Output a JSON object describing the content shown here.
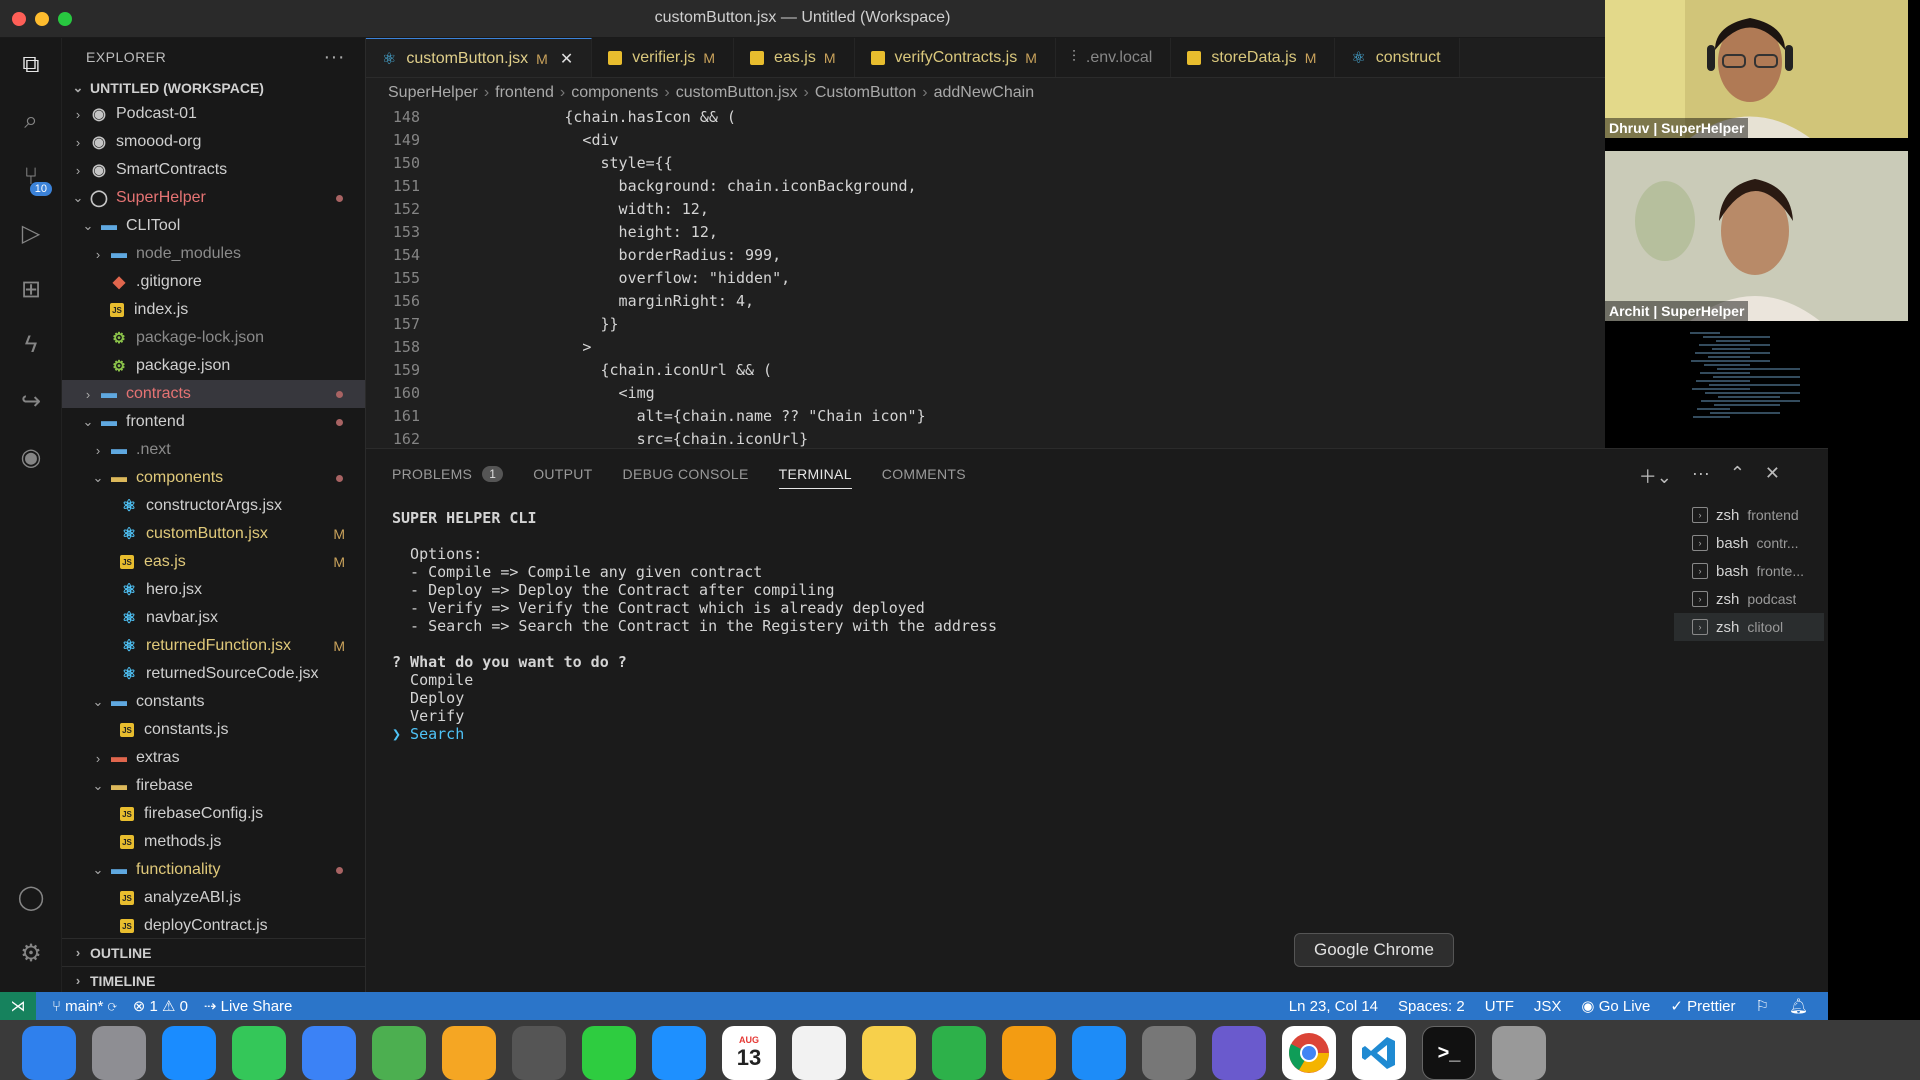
{
  "window": {
    "title": "customButton.jsx — Untitled (Workspace)"
  },
  "activity_bar": [
    {
      "icon": "files-icon"
    },
    {
      "icon": "search-icon"
    },
    {
      "icon": "source-control-icon",
      "badge": "10"
    },
    {
      "icon": "run-debug-icon"
    },
    {
      "icon": "extensions-icon"
    },
    {
      "icon": "lightning-icon"
    },
    {
      "icon": "live-share-icon"
    },
    {
      "icon": "github-icon"
    }
  ],
  "explorer": {
    "title": "EXPLORER",
    "workspace": "UNTITLED (WORKSPACE)",
    "items": [
      {
        "label": "Podcast-01",
        "depth": 0,
        "kind": "root",
        "chev": "›"
      },
      {
        "label": "smoood-org",
        "depth": 0,
        "kind": "root",
        "chev": "›"
      },
      {
        "label": "SmartContracts",
        "depth": 0,
        "kind": "root",
        "chev": "›"
      },
      {
        "label": "SuperHelper",
        "depth": 0,
        "kind": "root-open",
        "chev": "⌄",
        "color": "red",
        "dot": true
      },
      {
        "label": "CLITool",
        "depth": 1,
        "kind": "folder",
        "chev": "⌄"
      },
      {
        "label": "node_modules",
        "depth": 2,
        "kind": "folder-node",
        "chev": "›",
        "color": "dim"
      },
      {
        "label": ".gitignore",
        "depth": 2,
        "kind": "git"
      },
      {
        "label": "index.js",
        "depth": 2,
        "kind": "js"
      },
      {
        "label": "package-lock.json",
        "depth": 2,
        "kind": "json",
        "color": "dim"
      },
      {
        "label": "package.json",
        "depth": 2,
        "kind": "json"
      },
      {
        "label": "contracts",
        "depth": 1,
        "kind": "folder",
        "chev": "›",
        "color": "red",
        "dot": true,
        "selected": true
      },
      {
        "label": "frontend",
        "depth": 1,
        "kind": "folder",
        "chev": "⌄",
        "dot": true
      },
      {
        "label": ".next",
        "depth": 2,
        "kind": "folder",
        "chev": "›",
        "color": "dim"
      },
      {
        "label": "components",
        "depth": 2,
        "kind": "folder-y",
        "chev": "⌄",
        "color": "gold",
        "dot": true
      },
      {
        "label": "constructorArgs.jsx",
        "depth": 3,
        "kind": "react"
      },
      {
        "label": "customButton.jsx",
        "depth": 3,
        "kind": "react",
        "color": "gold",
        "mod": "M"
      },
      {
        "label": "eas.js",
        "depth": 3,
        "kind": "js",
        "color": "gold",
        "mod": "M"
      },
      {
        "label": "hero.jsx",
        "depth": 3,
        "kind": "react"
      },
      {
        "label": "navbar.jsx",
        "depth": 3,
        "kind": "react"
      },
      {
        "label": "returnedFunction.jsx",
        "depth": 3,
        "kind": "react",
        "color": "gold",
        "mod": "M"
      },
      {
        "label": "returnedSourceCode.jsx",
        "depth": 3,
        "kind": "react"
      },
      {
        "label": "constants",
        "depth": 2,
        "kind": "folder",
        "chev": "⌄"
      },
      {
        "label": "constants.js",
        "depth": 3,
        "kind": "js"
      },
      {
        "label": "extras",
        "depth": 2,
        "kind": "folder-r",
        "chev": "›"
      },
      {
        "label": "firebase",
        "depth": 2,
        "kind": "folder-y",
        "chev": "⌄"
      },
      {
        "label": "firebaseConfig.js",
        "depth": 3,
        "kind": "js"
      },
      {
        "label": "methods.js",
        "depth": 3,
        "kind": "js"
      },
      {
        "label": "functionality",
        "depth": 2,
        "kind": "folder",
        "chev": "⌄",
        "color": "gold",
        "dot": true
      },
      {
        "label": "analyzeABI.js",
        "depth": 3,
        "kind": "js"
      },
      {
        "label": "deployContract.js",
        "depth": 3,
        "kind": "js"
      }
    ],
    "outline": "OUTLINE",
    "timeline": "TIMELINE"
  },
  "tabs": [
    {
      "label": "customButton.jsx",
      "icon": "react-icon",
      "mod": "M",
      "active": true,
      "close": "✕"
    },
    {
      "label": "verifier.js",
      "icon": "js-icon",
      "mod": "M"
    },
    {
      "label": "eas.js",
      "icon": "js-icon",
      "mod": "M"
    },
    {
      "label": "verifyContracts.js",
      "icon": "js-icon",
      "mod": "M"
    },
    {
      "label": ".env.local",
      "icon": "env-icon",
      "grey": true
    },
    {
      "label": "storeData.js",
      "icon": "js-icon",
      "mod": "M"
    },
    {
      "label": "construct",
      "icon": "react-icon"
    }
  ],
  "breadcrumb": [
    "SuperHelper",
    "frontend",
    "components",
    "customButton.jsx",
    "CustomButton",
    "addNewChain"
  ],
  "code_lines": [
    {
      "n": "148",
      "t": "            {chain.hasIcon && ("
    },
    {
      "n": "149",
      "t": "              <div"
    },
    {
      "n": "150",
      "t": "                style={{"
    },
    {
      "n": "151",
      "t": "                  background: chain.iconBackground,"
    },
    {
      "n": "152",
      "t": "                  width: 12,"
    },
    {
      "n": "153",
      "t": "                  height: 12,"
    },
    {
      "n": "154",
      "t": "                  borderRadius: 999,"
    },
    {
      "n": "155",
      "t": "                  overflow: \"hidden\","
    },
    {
      "n": "156",
      "t": "                  marginRight: 4,"
    },
    {
      "n": "157",
      "t": "                }}"
    },
    {
      "n": "158",
      "t": "              >"
    },
    {
      "n": "159",
      "t": "                {chain.iconUrl && ("
    },
    {
      "n": "160",
      "t": "                  <img"
    },
    {
      "n": "161",
      "t": "                    alt={chain.name ?? \"Chain icon\"}"
    },
    {
      "n": "162",
      "t": "                    src={chain.iconUrl}"
    }
  ],
  "panel": {
    "tabs": [
      {
        "label": "PROBLEMS",
        "badge": "1"
      },
      {
        "label": "OUTPUT"
      },
      {
        "label": "DEBUG CONSOLE"
      },
      {
        "label": "TERMINAL",
        "active": true
      },
      {
        "label": "COMMENTS"
      }
    ],
    "terminal_lines": [
      {
        "t": "SUPER HELPER CLI",
        "bold": true
      },
      {
        "t": ""
      },
      {
        "t": "  Options:"
      },
      {
        "t": "  - Compile => Compile any given contract"
      },
      {
        "t": "  - Deploy => Deploy the Contract after compiling"
      },
      {
        "t": "  - Verify => Verify the Contract which is already deployed"
      },
      {
        "t": "  - Search => Search the Contract in the Registery with the address"
      },
      {
        "t": ""
      },
      {
        "t": "? What do you want to do ?",
        "bold": true
      },
      {
        "t": "  Compile"
      },
      {
        "t": "  Deploy"
      },
      {
        "t": "  Verify"
      },
      {
        "t": "❯ Search",
        "color": "#4fc3f7"
      }
    ],
    "terminals": [
      {
        "shell": "zsh",
        "name": "frontend"
      },
      {
        "shell": "bash",
        "name": "contr..."
      },
      {
        "shell": "bash",
        "name": "fronte..."
      },
      {
        "shell": "zsh",
        "name": "podcast"
      },
      {
        "shell": "zsh",
        "name": "clitool",
        "selected": true
      }
    ]
  },
  "status_bar": {
    "branch": "main*",
    "problems": "⊗ 1 ⚠ 0",
    "live_share": "Live Share",
    "position": "Ln 23, Col 14",
    "spaces": "Spaces: 2",
    "encoding": "UTF",
    "lang": "JSX",
    "go_live": "Go Live",
    "prettier": "Prettier"
  },
  "tooltip": "Google Chrome",
  "dock": [
    {
      "name": "finder",
      "color": "#2f80ed"
    },
    {
      "name": "launchpad",
      "color": "#8e8e93"
    },
    {
      "name": "safari",
      "color": "#1a8cff"
    },
    {
      "name": "messages",
      "color": "#34c759"
    },
    {
      "name": "mail",
      "color": "#3b82f6"
    },
    {
      "name": "maps",
      "color": "#4caf50"
    },
    {
      "name": "photos",
      "color": "#f5a623"
    },
    {
      "name": "calculator",
      "color": "#555"
    },
    {
      "name": "facetime",
      "color": "#2ecc40"
    },
    {
      "name": "keynote",
      "color": "#1e90ff"
    },
    {
      "name": "calendar",
      "color": "#ffffff",
      "text": "13",
      "month": "AUG"
    },
    {
      "name": "reminders",
      "color": "#f2f2f2"
    },
    {
      "name": "notes",
      "color": "#f7d04b"
    },
    {
      "name": "numbers",
      "color": "#2db14a"
    },
    {
      "name": "pages",
      "color": "#f39c12"
    },
    {
      "name": "app-store",
      "color": "#1d8cf8"
    },
    {
      "name": "system-settings",
      "color": "#777"
    },
    {
      "name": "arc",
      "color": "#6a5acd"
    },
    {
      "name": "google-chrome",
      "color": "#ffffff"
    },
    {
      "name": "vscode",
      "color": "#ffffff"
    },
    {
      "name": "terminal",
      "color": "#111"
    },
    {
      "name": "trash",
      "color": "#999"
    }
  ],
  "video_tiles": [
    {
      "name": "Dhruv | SuperHelper",
      "bg": "#cfc37a"
    },
    {
      "name": "Archit | SuperHelper",
      "bg": "#c9cbb9"
    }
  ]
}
